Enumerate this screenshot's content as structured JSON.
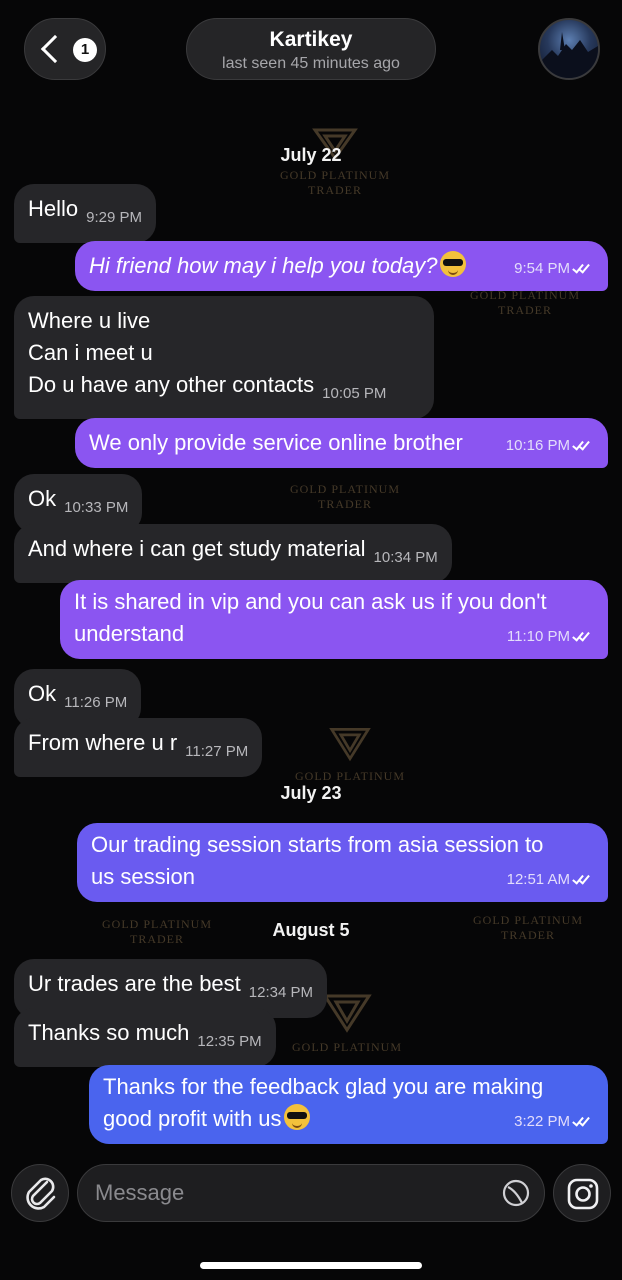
{
  "header": {
    "back_badge": "1",
    "contact_name": "Kartikey",
    "status": "last seen 45 minutes ago"
  },
  "watermark": {
    "line1": "GOLD PLATINUM",
    "line2": "TRADER"
  },
  "dates": [
    "July 22",
    "July 23",
    "August 5"
  ],
  "messages": [
    {
      "dir": "in",
      "lines": [
        "Hello"
      ],
      "time": "9:29 PM"
    },
    {
      "dir": "out",
      "lines": [
        "Hi friend how may i help you today?"
      ],
      "time": "9:54 PM",
      "emoji": "smiling-face-with-sunglasses"
    },
    {
      "dir": "in",
      "lines": [
        "Where u live",
        "Can i meet u",
        "Do u have any other contacts"
      ],
      "time": "10:05 PM"
    },
    {
      "dir": "out",
      "lines": [
        "We only provide service online brother"
      ],
      "time": "10:16 PM"
    },
    {
      "dir": "in",
      "lines": [
        "Ok"
      ],
      "time": "10:33 PM"
    },
    {
      "dir": "in",
      "lines": [
        "And where i can get study material"
      ],
      "time": "10:34 PM"
    },
    {
      "dir": "out",
      "lines": [
        "It is shared in vip and you can ask us if you don't",
        "understand"
      ],
      "time": "11:10 PM"
    },
    {
      "dir": "in",
      "lines": [
        "Ok"
      ],
      "time": "11:26 PM"
    },
    {
      "dir": "in",
      "lines": [
        "From where u r"
      ],
      "time": "11:27 PM"
    },
    {
      "dir": "out",
      "lines": [
        "Our trading session starts from asia session to",
        "us session"
      ],
      "time": "12:51 AM"
    },
    {
      "dir": "in",
      "lines": [
        "Ur trades are the best"
      ],
      "time": "12:34 PM"
    },
    {
      "dir": "in",
      "lines": [
        "Thanks so much"
      ],
      "time": "12:35 PM"
    },
    {
      "dir": "out",
      "lines": [
        "Thanks for the feedback glad you are making",
        "good profit with us"
      ],
      "time": "3:22 PM",
      "emoji": "smiling-face-with-sunglasses"
    }
  ],
  "composer": {
    "placeholder": "Message"
  },
  "colors": {
    "background": "#060607",
    "incoming_bubble": "#262629",
    "outgoing_purple": "#8b55f1",
    "outgoing_indigo": "#6a5bf0",
    "outgoing_blue": "#4a64ee",
    "watermark": "#5a4a33"
  },
  "icons": [
    "back-chevron-icon",
    "avatar",
    "double-check-icon",
    "sunglasses-emoji-icon",
    "paperclip-icon",
    "sticker-icon",
    "instagram-icon"
  ]
}
